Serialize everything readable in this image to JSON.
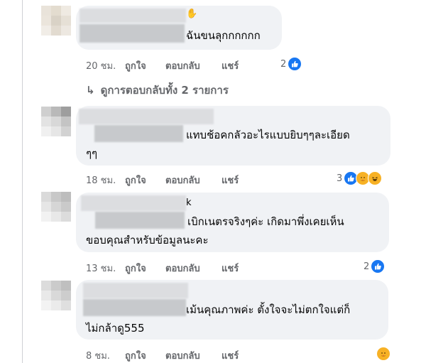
{
  "comments": [
    {
      "text_lines": [
        "ฉันขนลุกกกกกก"
      ],
      "time": "20 ชม.",
      "like_label": "ถูกใจ",
      "reply_label": "ตอบกลับ",
      "share_label": "แชร์",
      "reaction_count": "2",
      "reactions": [
        "like-icon"
      ],
      "view_replies": "ดูการตอบกลับทั้ง 2 รายการ"
    },
    {
      "text_lines": [
        "แทบช้อคกลัวอะไรแบบยิบๆๆละเอียด",
        "ๆๆ"
      ],
      "time": "18 ชม.",
      "like_label": "ถูกใจ",
      "reply_label": "ตอบกลับ",
      "share_label": "แชร์",
      "reaction_count": "3",
      "reactions": [
        "like-icon",
        "care-icon",
        "haha-icon"
      ]
    },
    {
      "text_lines": [
        "เบิกเนตรจริงๆค่ะ เกิดมาพึ่งเคยเห็น",
        "ขอบคุณสำหรับข้อมูลนะคะ"
      ],
      "time": "13 ชม.",
      "like_label": "ถูกใจ",
      "reply_label": "ตอบกลับ",
      "share_label": "แชร์",
      "reaction_count": "2",
      "reactions": [
        "like-icon"
      ]
    },
    {
      "text_lines": [
        "เม้นคุณภาพค่ะ ตั้งใจจะไม่ตกใจแต่ก็",
        "ไม่กล้าดู555"
      ],
      "time": "8 ชม.",
      "like_label": "ถูกใจ",
      "reply_label": "ตอบกลับ",
      "share_label": "แชร์",
      "reaction_count": "",
      "reactions": [
        "care-icon"
      ]
    }
  ],
  "colors": {
    "bubble": "#f0f2f5",
    "meta_text": "#65676b",
    "like_blue": "#1877f2"
  }
}
